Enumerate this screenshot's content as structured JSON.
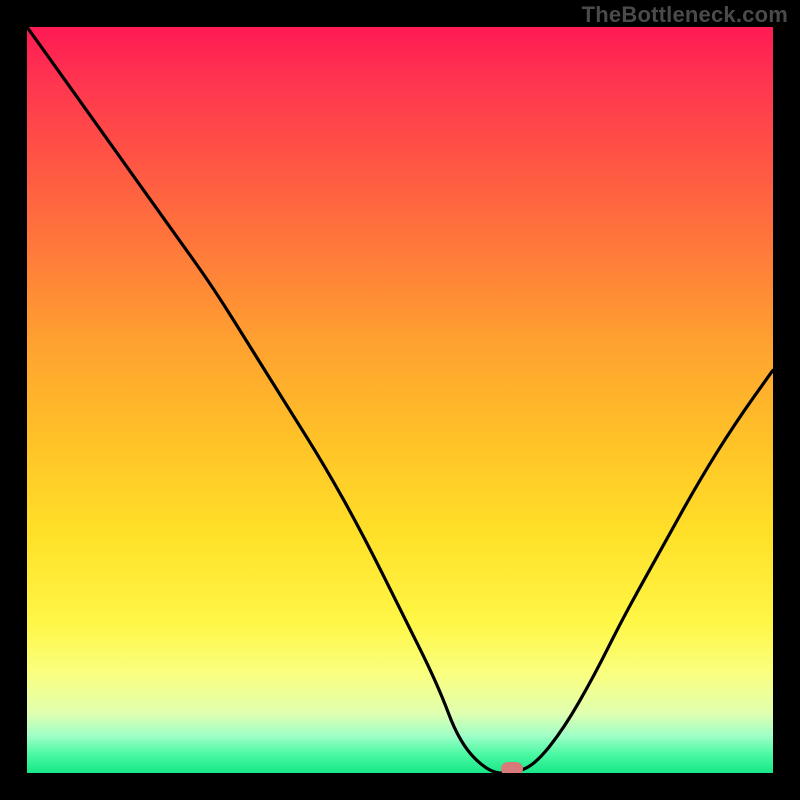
{
  "watermark": "TheBottleneck.com",
  "colors": {
    "frame": "#000000",
    "marker": "#d97a7a",
    "curve": "#000000"
  },
  "chart_data": {
    "type": "line",
    "title": "",
    "xlabel": "",
    "ylabel": "",
    "xlim": [
      0,
      100
    ],
    "ylim": [
      0,
      100
    ],
    "grid": false,
    "legend": false,
    "x": [
      0,
      5,
      10,
      15,
      20,
      25,
      30,
      35,
      40,
      45,
      50,
      55,
      58,
      62,
      65,
      68,
      72,
      76,
      80,
      85,
      90,
      95,
      100
    ],
    "values": [
      100,
      93,
      86,
      79,
      72,
      65,
      57,
      49,
      41,
      32,
      22,
      12,
      4,
      0,
      0,
      1,
      6,
      13,
      21,
      30,
      39,
      47,
      54
    ],
    "marker": {
      "x": 65,
      "y": 0
    },
    "background_gradient_stops": [
      {
        "pos": 0.0,
        "color": "#ff1a54"
      },
      {
        "pos": 0.5,
        "color": "#ffb22c"
      },
      {
        "pos": 0.8,
        "color": "#fff747"
      },
      {
        "pos": 1.0,
        "color": "#17e887"
      }
    ]
  }
}
